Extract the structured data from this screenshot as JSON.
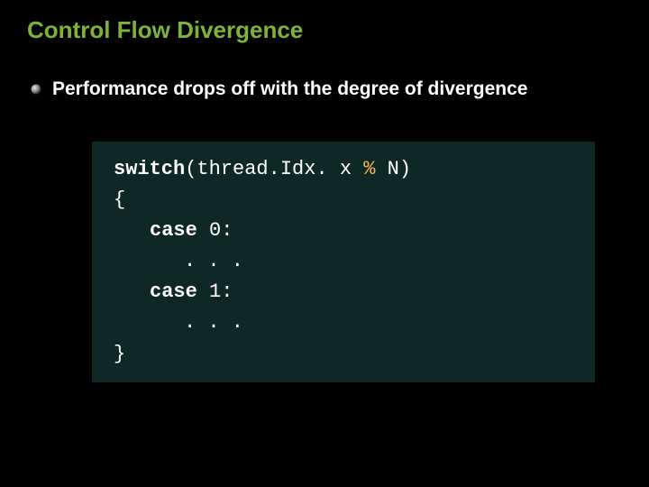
{
  "slide": {
    "title": "Control Flow Divergence",
    "bullet": "Performance drops off with the degree of divergence",
    "code": {
      "switch_kw": "switch",
      "switch_expr_open": "(thread.Idx. x ",
      "switch_expr_pct": "% ",
      "switch_expr_n": "N",
      "switch_close": ")",
      "brace_open": "{",
      "case0_kw": "case",
      "case0_rest": " 0:",
      "ellipsis0": ". . .",
      "case1_kw": "case",
      "case1_rest": " 1:",
      "ellipsis1": ". . .",
      "brace_close": "}"
    }
  }
}
